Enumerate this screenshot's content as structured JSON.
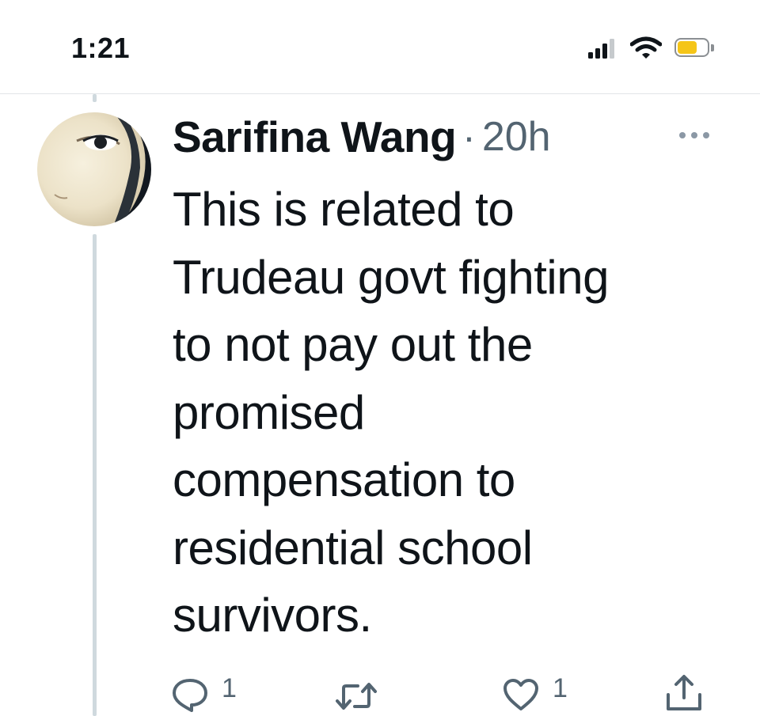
{
  "status_bar": {
    "time": "1:21",
    "icons": [
      "signal-icon",
      "wifi-icon",
      "battery-icon"
    ],
    "battery_color": "#f5c518"
  },
  "tweet": {
    "author": {
      "display_name": "Sarifina Wang",
      "avatar_icon": "avatar"
    },
    "separator": "·",
    "timestamp": "20h",
    "more_icon": "more-icon",
    "text": "This is related to\nTrudeau govt fighting\nto not pay out the\npromised\ncompensation to\nresidential school\nsurvivors.",
    "actions": {
      "reply": {
        "icon": "reply-icon",
        "count": "1"
      },
      "retweet": {
        "icon": "retweet-icon",
        "count": ""
      },
      "like": {
        "icon": "heart-icon",
        "count": "1"
      },
      "share": {
        "icon": "share-icon"
      }
    }
  },
  "colors": {
    "text_primary": "#0f1419",
    "text_secondary": "#536471",
    "thread_line": "#cfd9de"
  }
}
